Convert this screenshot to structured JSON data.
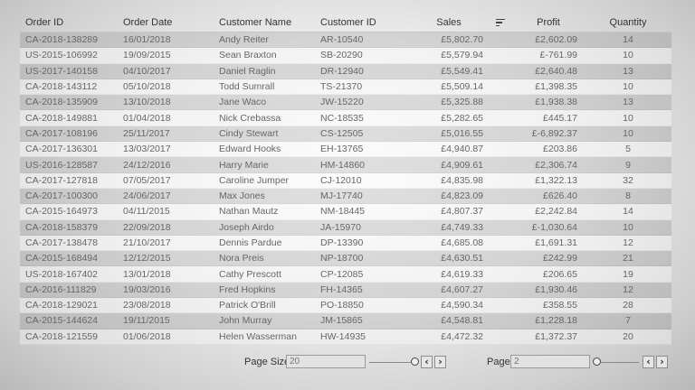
{
  "columns": {
    "order_id": "Order ID",
    "order_date": "Order Date",
    "customer_name": "Customer Name",
    "customer_id": "Customer ID",
    "sales": "Sales",
    "profit": "Profit",
    "quantity": "Quantity"
  },
  "sort_icon": "sort-descending-icon",
  "rows": [
    {
      "order_id": "CA-2018-138289",
      "order_date": "16/01/2018",
      "customer_name": "Andy Reiter",
      "customer_id": "AR-10540",
      "sales": "£5,802.70",
      "profit": "£2,602.09",
      "quantity": "14"
    },
    {
      "order_id": "US-2015-106992",
      "order_date": "19/09/2015",
      "customer_name": "Sean Braxton",
      "customer_id": "SB-20290",
      "sales": "£5,579.94",
      "profit": "£-761.99",
      "quantity": "10"
    },
    {
      "order_id": "US-2017-140158",
      "order_date": "04/10/2017",
      "customer_name": "Daniel Raglin",
      "customer_id": "DR-12940",
      "sales": "£5,549.41",
      "profit": "£2,640.48",
      "quantity": "13"
    },
    {
      "order_id": "CA-2018-143112",
      "order_date": "05/10/2018",
      "customer_name": "Todd Sumrall",
      "customer_id": "TS-21370",
      "sales": "£5,509.14",
      "profit": "£1,398.35",
      "quantity": "10"
    },
    {
      "order_id": "CA-2018-135909",
      "order_date": "13/10/2018",
      "customer_name": "Jane Waco",
      "customer_id": "JW-15220",
      "sales": "£5,325.88",
      "profit": "£1,938.38",
      "quantity": "13"
    },
    {
      "order_id": "CA-2018-149881",
      "order_date": "01/04/2018",
      "customer_name": "Nick Crebassa",
      "customer_id": "NC-18535",
      "sales": "£5,282.65",
      "profit": "£445.17",
      "quantity": "10"
    },
    {
      "order_id": "CA-2017-108196",
      "order_date": "25/11/2017",
      "customer_name": "Cindy Stewart",
      "customer_id": "CS-12505",
      "sales": "£5,016.55",
      "profit": "£-6,892.37",
      "quantity": "10"
    },
    {
      "order_id": "CA-2017-136301",
      "order_date": "13/03/2017",
      "customer_name": "Edward Hooks",
      "customer_id": "EH-13765",
      "sales": "£4,940.87",
      "profit": "£203.86",
      "quantity": "5"
    },
    {
      "order_id": "US-2016-128587",
      "order_date": "24/12/2016",
      "customer_name": "Harry Marie",
      "customer_id": "HM-14860",
      "sales": "£4,909.61",
      "profit": "£2,306.74",
      "quantity": "9"
    },
    {
      "order_id": "CA-2017-127818",
      "order_date": "07/05/2017",
      "customer_name": "Caroline Jumper",
      "customer_id": "CJ-12010",
      "sales": "£4,835.98",
      "profit": "£1,322.13",
      "quantity": "32"
    },
    {
      "order_id": "CA-2017-100300",
      "order_date": "24/06/2017",
      "customer_name": "Max Jones",
      "customer_id": "MJ-17740",
      "sales": "£4,823.09",
      "profit": "£626.40",
      "quantity": "8"
    },
    {
      "order_id": "CA-2015-164973",
      "order_date": "04/11/2015",
      "customer_name": "Nathan Mautz",
      "customer_id": "NM-18445",
      "sales": "£4,807.37",
      "profit": "£2,242.84",
      "quantity": "14"
    },
    {
      "order_id": "CA-2018-158379",
      "order_date": "22/09/2018",
      "customer_name": "Joseph Airdo",
      "customer_id": "JA-15970",
      "sales": "£4,749.33",
      "profit": "£-1,030.64",
      "quantity": "10"
    },
    {
      "order_id": "CA-2017-138478",
      "order_date": "21/10/2017",
      "customer_name": "Dennis Pardue",
      "customer_id": "DP-13390",
      "sales": "£4,685.08",
      "profit": "£1,691.31",
      "quantity": "12"
    },
    {
      "order_id": "CA-2015-168494",
      "order_date": "12/12/2015",
      "customer_name": "Nora Preis",
      "customer_id": "NP-18700",
      "sales": "£4,630.51",
      "profit": "£242.99",
      "quantity": "21"
    },
    {
      "order_id": "US-2018-167402",
      "order_date": "13/01/2018",
      "customer_name": "Cathy Prescott",
      "customer_id": "CP-12085",
      "sales": "£4,619.33",
      "profit": "£206.65",
      "quantity": "19"
    },
    {
      "order_id": "CA-2016-111829",
      "order_date": "19/03/2016",
      "customer_name": "Fred Hopkins",
      "customer_id": "FH-14365",
      "sales": "£4,607.27",
      "profit": "£1,930.46",
      "quantity": "12"
    },
    {
      "order_id": "CA-2018-129021",
      "order_date": "23/08/2018",
      "customer_name": "Patrick O'Brill",
      "customer_id": "PO-18850",
      "sales": "£4,590.34",
      "profit": "£358.55",
      "quantity": "28"
    },
    {
      "order_id": "CA-2015-144624",
      "order_date": "19/11/2015",
      "customer_name": "John Murray",
      "customer_id": "JM-15865",
      "sales": "£4,548.81",
      "profit": "£1,228.18",
      "quantity": "7"
    },
    {
      "order_id": "CA-2018-121559",
      "order_date": "01/06/2018",
      "customer_name": "Helen Wasserman",
      "customer_id": "HW-14935",
      "sales": "£4,472.32",
      "profit": "£1,372.37",
      "quantity": "20"
    }
  ],
  "pager": {
    "page_size_label": "Page Size",
    "page_size_value": "20",
    "page_label": "Page",
    "page_value": "2",
    "prev_icon": "chevron-left-icon",
    "next_icon": "chevron-right-icon",
    "prev_glyph": "‹",
    "next_glyph": "›"
  }
}
